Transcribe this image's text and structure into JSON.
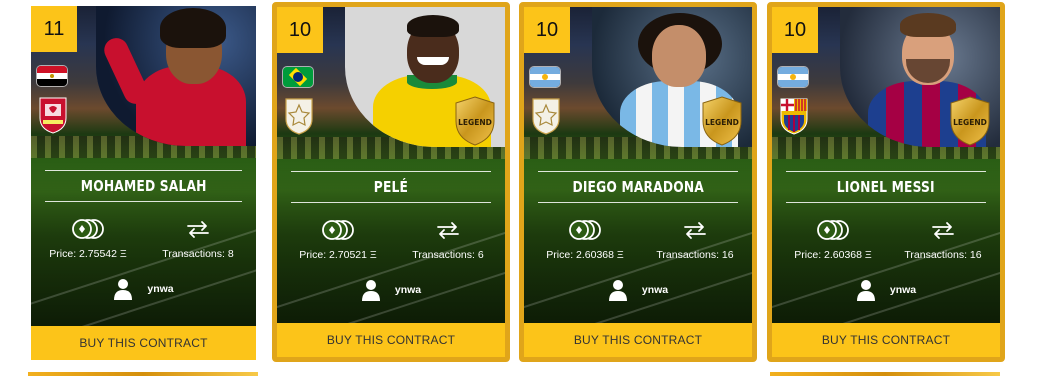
{
  "cards": [
    {
      "rank": "11",
      "name": "MOHAMED SALAH",
      "price_label": "Price: 2.75542 Ξ",
      "transactions_label": "Transactions: 8",
      "owner": "ynwa",
      "buy_label": "BUY THIS CONTRACT",
      "nation_flag": "egypt-flag-icon",
      "club_badge": "liverpool-badge-icon",
      "legend": false
    },
    {
      "rank": "10",
      "name": "PELÉ",
      "price_label": "Price: 2.70521 Ξ",
      "transactions_label": "Transactions: 6",
      "owner": "ynwa",
      "buy_label": "BUY THIS CONTRACT",
      "nation_flag": "brazil-flag-icon",
      "club_badge": "icon-badge-icon",
      "legend": true,
      "legend_label": "LEGEND"
    },
    {
      "rank": "10",
      "name": "DIEGO MARADONA",
      "price_label": "Price: 2.60368 Ξ",
      "transactions_label": "Transactions: 16",
      "owner": "ynwa",
      "buy_label": "BUY THIS CONTRACT",
      "nation_flag": "argentina-flag-icon",
      "club_badge": "icon-badge-icon",
      "legend": true,
      "legend_label": "LEGEND"
    },
    {
      "rank": "10",
      "name": "LIONEL MESSI",
      "price_label": "Price: 2.60368 Ξ",
      "transactions_label": "Transactions: 16",
      "owner": "ynwa",
      "buy_label": "BUY THIS CONTRACT",
      "nation_flag": "argentina-flag-icon",
      "club_badge": "barcelona-badge-icon",
      "legend": true,
      "legend_label": "LEGEND"
    }
  ],
  "colors": {
    "accent_yellow": "#fcc419",
    "gold_border": "#e0a51a",
    "text_white": "#ffffff",
    "button_text": "#333333"
  }
}
